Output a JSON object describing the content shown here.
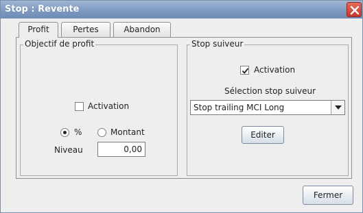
{
  "window": {
    "title": "Stop : Revente"
  },
  "tabs": [
    {
      "label": "Profit",
      "active": true
    },
    {
      "label": "Pertes",
      "active": false
    },
    {
      "label": "Abandon",
      "active": false
    }
  ],
  "objectif_profit": {
    "title": "Objectif de profit",
    "activation_label": "Activation",
    "activation_checked": false,
    "radio_percent_label": "%",
    "radio_montant_label": "Montant",
    "selected_mode": "%",
    "niveau_label": "Niveau",
    "niveau_value": "0,00"
  },
  "stop_suiveur": {
    "title": "Stop suiveur",
    "activation_label": "Activation",
    "activation_checked": true,
    "selection_label": "Sélection stop suiveur",
    "selected_value": "Stop trailing MCI Long",
    "edit_button": "Editer"
  },
  "footer": {
    "close_button": "Fermer"
  },
  "colors": {
    "titlebar": "#7f9ac1",
    "close_button": "#c8372a",
    "background": "#eeeeee"
  },
  "icons": {
    "close": "close-icon",
    "checkmark": "checkmark-icon",
    "dropdown": "chevron-down-icon"
  }
}
